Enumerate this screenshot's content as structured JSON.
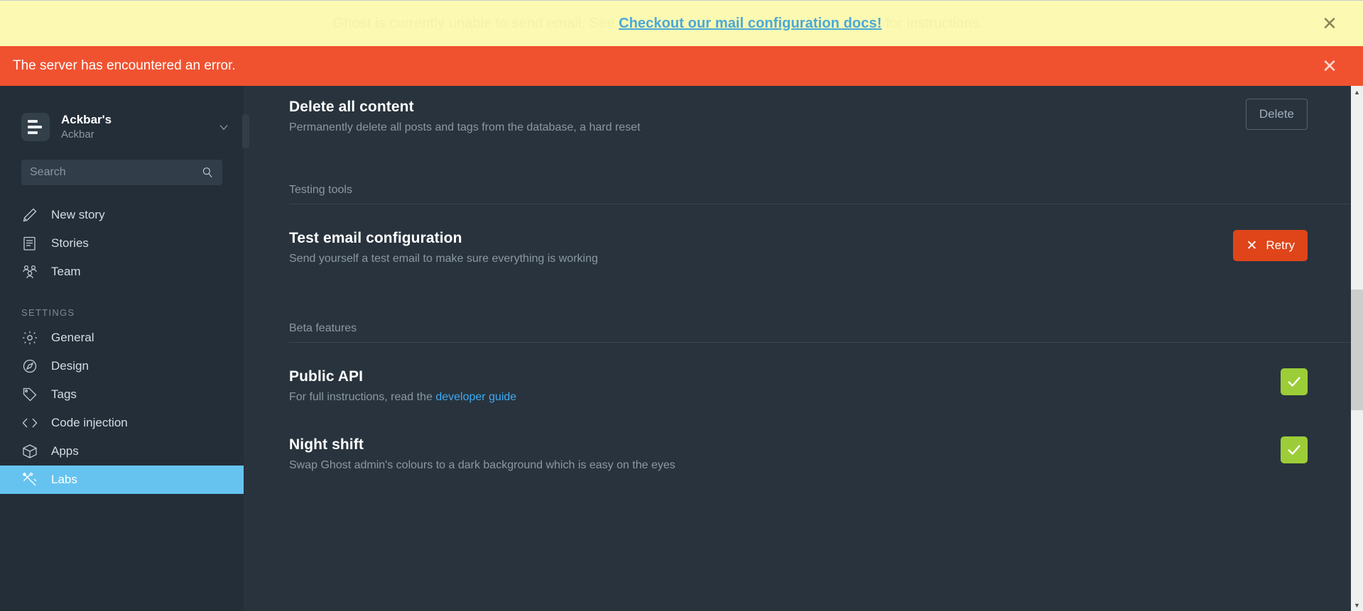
{
  "notifications": [
    {
      "type": "warning",
      "text_before": "Ghost is currently unable to send email. See",
      "link": "Checkout our mail configuration docs!",
      "text_after": "for instructions.",
      "close_icon": "close-icon",
      "bg": "#fbf9b2",
      "text_color": "#f6f2a8",
      "link_color": "#4aa8d8"
    },
    {
      "type": "error",
      "text": "The server has encountered an error.",
      "close_icon": "close-icon",
      "bg": "#f05230",
      "text_color": "#ffffff"
    }
  ],
  "sidebar": {
    "blog": {
      "title": "Ackbar's",
      "subtitle": "Ackbar",
      "avatar_icon": "blog-logo-icon",
      "chevron_icon": "chevron-down-icon"
    },
    "search": {
      "placeholder": "Search",
      "value": "",
      "icon": "search-icon"
    },
    "primary_items": [
      {
        "label": "New story",
        "icon": "pencil-icon",
        "active": false
      },
      {
        "label": "Stories",
        "icon": "notepad-icon",
        "active": false
      },
      {
        "label": "Team",
        "icon": "users-icon",
        "active": false
      }
    ],
    "section_label": "SETTINGS",
    "settings_items": [
      {
        "label": "General",
        "icon": "gear-icon",
        "active": false
      },
      {
        "label": "Design",
        "icon": "compass-icon",
        "active": false
      },
      {
        "label": "Tags",
        "icon": "tag-icon",
        "active": false
      },
      {
        "label": "Code injection",
        "icon": "code-icon",
        "active": false
      },
      {
        "label": "Apps",
        "icon": "box-icon",
        "active": false
      },
      {
        "label": "Labs",
        "icon": "tools-icon",
        "active": true
      }
    ],
    "active_color": "#66c3ef",
    "bg": "#242e38"
  },
  "main": {
    "rows": [
      {
        "title": "Delete all content",
        "desc": "Permanently delete all posts and tags from the database, a hard reset",
        "action_type": "button-outline",
        "action_label": "Delete",
        "action_name": "delete-all-content-button"
      }
    ],
    "sections": [
      {
        "label": "Testing tools",
        "rows": [
          {
            "title": "Test email configuration",
            "desc": "Send yourself a test email to make sure everything is working",
            "action_type": "button-danger",
            "action_label": "Retry",
            "action_icon": "close-icon",
            "action_name": "test-email-retry-button",
            "action_color": "#df4519"
          }
        ]
      },
      {
        "label": "Beta features",
        "rows": [
          {
            "title": "Public API",
            "desc_before": "For full instructions, read the ",
            "desc_link": "developer guide",
            "desc_after": "",
            "action_type": "checkbox",
            "action_checked": true,
            "action_name": "public-api-toggle",
            "action_color": "#9ccd38"
          },
          {
            "title": "Night shift",
            "desc": "Swap Ghost admin's colours to a dark background which is easy on the eyes",
            "action_type": "checkbox",
            "action_checked": true,
            "action_name": "night-shift-toggle",
            "action_color": "#9ccd38"
          }
        ]
      }
    ]
  },
  "scrollbar": {
    "up_arrow": "▲",
    "down_arrow": "▼"
  }
}
